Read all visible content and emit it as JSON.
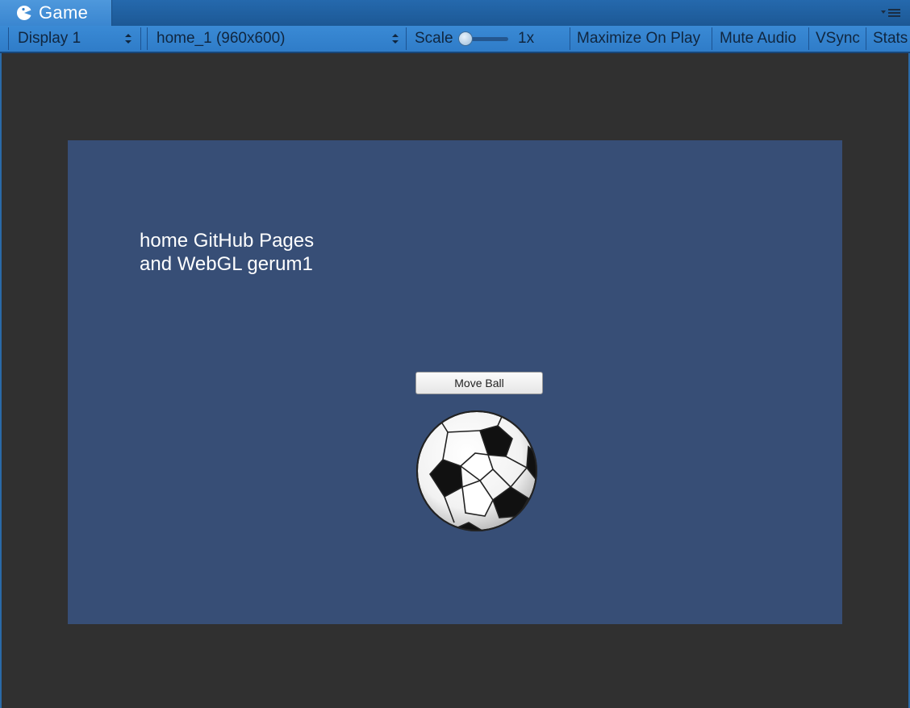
{
  "tab": {
    "title": "Game",
    "icon": "pacman-game-icon"
  },
  "toolbar": {
    "display": "Display 1",
    "resolution": "home_1 (960x600)",
    "scale_label": "Scale",
    "scale_value": "1x",
    "scale_slider_level": 0,
    "maximize_on_play": "Maximize On Play",
    "mute_audio": "Mute Audio",
    "vsync": "VSync",
    "stats": "Stats"
  },
  "game": {
    "text_line1": "home GitHub Pages",
    "text_line2": "and WebGL gerum1",
    "move_ball_button": "Move Ball",
    "background_color": "#374e76",
    "ball": "soccer-ball"
  },
  "colors": {
    "editor_blue": "#3a86d0",
    "viewport_bg": "#303030"
  }
}
